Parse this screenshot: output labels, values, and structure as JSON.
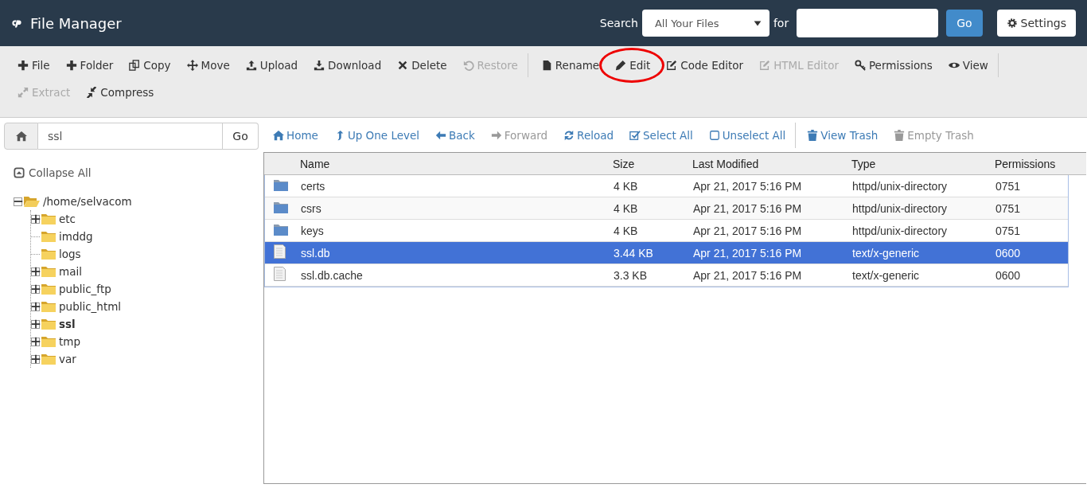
{
  "header": {
    "title": "File Manager",
    "search_label": "Search",
    "search_scope": "All Your Files",
    "for_label": "for",
    "go_button": "Go",
    "settings_button": "Settings"
  },
  "toolbar": {
    "groups": [
      [
        {
          "label": "File",
          "disabled": false,
          "circled": false
        },
        {
          "label": "Folder",
          "disabled": false,
          "circled": false
        },
        {
          "label": "Copy",
          "disabled": false,
          "circled": false
        },
        {
          "label": "Move",
          "disabled": false,
          "circled": false
        },
        {
          "label": "Upload",
          "disabled": false,
          "circled": false
        },
        {
          "label": "Download",
          "disabled": false,
          "circled": false
        },
        {
          "label": "Delete",
          "disabled": false,
          "circled": false
        },
        {
          "label": "Restore",
          "disabled": true,
          "circled": false
        }
      ],
      [
        {
          "label": "Rename",
          "disabled": false,
          "circled": false
        },
        {
          "label": "Edit",
          "disabled": false,
          "circled": true
        },
        {
          "label": "Code Editor",
          "disabled": false,
          "circled": false
        },
        {
          "label": "HTML Editor",
          "disabled": true,
          "circled": false
        },
        {
          "label": "Permissions",
          "disabled": false,
          "circled": false
        },
        {
          "label": "View",
          "disabled": false,
          "circled": false
        }
      ],
      [
        {
          "label": "Extract",
          "disabled": true,
          "circled": false
        },
        {
          "label": "Compress",
          "disabled": false,
          "circled": false
        }
      ]
    ]
  },
  "path_bar": {
    "value": "ssl",
    "go_button": "Go"
  },
  "collapse_all": "Collapse All",
  "tree": [
    {
      "label": "/home/selvacom",
      "expanded": true,
      "selected": false,
      "expandable": true,
      "children": [
        {
          "label": "etc",
          "expanded": false,
          "selected": false,
          "expandable": true
        },
        {
          "label": "imddg",
          "expanded": false,
          "selected": false,
          "expandable": false
        },
        {
          "label": "logs",
          "expanded": false,
          "selected": false,
          "expandable": false
        },
        {
          "label": "mail",
          "expanded": false,
          "selected": false,
          "expandable": true
        },
        {
          "label": "public_ftp",
          "expanded": false,
          "selected": false,
          "expandable": true
        },
        {
          "label": "public_html",
          "expanded": false,
          "selected": false,
          "expandable": true
        },
        {
          "label": "ssl",
          "expanded": false,
          "selected": true,
          "expandable": true
        },
        {
          "label": "tmp",
          "expanded": false,
          "selected": false,
          "expandable": true
        },
        {
          "label": "var",
          "expanded": false,
          "selected": false,
          "expandable": true
        }
      ]
    }
  ],
  "nav": [
    [
      {
        "label": "Home",
        "disabled": false
      },
      {
        "label": "Up One Level",
        "disabled": false
      },
      {
        "label": "Back",
        "disabled": false
      },
      {
        "label": "Forward",
        "disabled": true
      },
      {
        "label": "Reload",
        "disabled": false
      },
      {
        "label": "Select All",
        "disabled": false
      },
      {
        "label": "Unselect All",
        "disabled": false
      }
    ],
    [
      {
        "label": "View Trash",
        "disabled": false
      },
      {
        "label": "Empty Trash",
        "disabled": true
      }
    ]
  ],
  "table": {
    "columns": [
      "Name",
      "Size",
      "Last Modified",
      "Type",
      "Permissions"
    ],
    "rows": [
      {
        "kind": "folder",
        "selected": false,
        "cells": [
          "certs",
          "4 KB",
          "Apr 21, 2017 5:16 PM",
          "httpd/unix-directory",
          "0751"
        ]
      },
      {
        "kind": "folder",
        "selected": false,
        "cells": [
          "csrs",
          "4 KB",
          "Apr 21, 2017 5:16 PM",
          "httpd/unix-directory",
          "0751"
        ]
      },
      {
        "kind": "folder",
        "selected": false,
        "cells": [
          "keys",
          "4 KB",
          "Apr 21, 2017 5:16 PM",
          "httpd/unix-directory",
          "0751"
        ]
      },
      {
        "kind": "file",
        "selected": true,
        "cells": [
          "ssl.db",
          "3.44 KB",
          "Apr 21, 2017 5:16 PM",
          "text/x-generic",
          "0600"
        ]
      },
      {
        "kind": "file",
        "selected": false,
        "cells": [
          "ssl.db.cache",
          "3.3 KB",
          "Apr 21, 2017 5:16 PM",
          "text/x-generic",
          "0600"
        ]
      }
    ]
  }
}
